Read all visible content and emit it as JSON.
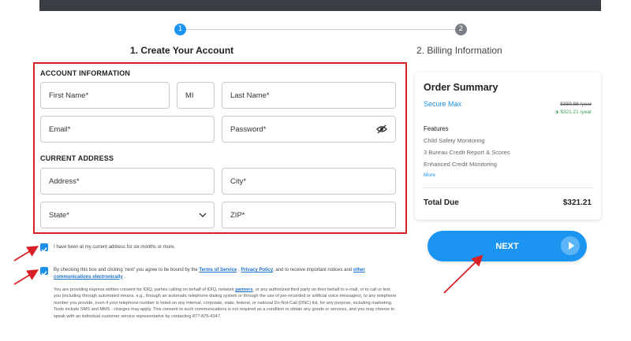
{
  "steps": [
    {
      "number": "1",
      "label": "1. Create Your Account"
    },
    {
      "number": "2",
      "label": "2. Billing Information"
    }
  ],
  "form": {
    "account_section": "ACCOUNT INFORMATION",
    "first_name_placeholder": "First Name*",
    "mi_placeholder": "MI",
    "last_name_placeholder": "Last Name*",
    "email_placeholder": "Email*",
    "password_placeholder": "Password*",
    "address_section": "CURRENT ADDRESS",
    "address_placeholder": "Address*",
    "city_placeholder": "City*",
    "state_placeholder": "State*",
    "zip_placeholder": "ZIP*"
  },
  "summary": {
    "title": "Order Summary",
    "plan_name": "Secure Max",
    "old_price": "$359.88 /year",
    "new_price": "$321.21 /year",
    "features_heading": "Features",
    "features": [
      "Child Safety Monitoring",
      "3 Bureau Credit Report & Scores",
      "Enhanced Credit Monitoring"
    ],
    "more_link": "More",
    "total_label": "Total Due",
    "total_value": "$321.21"
  },
  "next_button": "NEXT",
  "consent": {
    "address_checkbox": "I have been at my current address for six months or more.",
    "terms_prefix": "By checking this box and clicking 'next' you agree to be bound by the",
    "terms_link": "Terms of Service",
    "comma": ",",
    "privacy_link": "Privacy Policy",
    "terms_middle": ", and to receive important notices and",
    "other_comms_link": "other communications electronically",
    "period": "."
  },
  "legal": {
    "part1": "You are providing express written consent for IDIQ, parties calling on behalf of IDIQ, network",
    "partners_link": "partners",
    "part2": ", or any authorized third party on their behalf to e-mail, or to call or text you (including through automated means, e.g., through an automatic telephone dialing system or through the use of pre-recorded or artificial voice messages), to any telephone number you provide, even if your telephone number is listed on any internal, corporate, state, federal, or national Do-Not-Call (DNC) list, for any purpose, including marketing. Texts include SMS and MMS - charges may apply. This consent to such communications is not required as a condition to obtain any goods or services, and you may choose to speak with an individual customer service representative by contacting 877-875-4347."
  },
  "colors": {
    "accent": "#1c95f2",
    "highlight_border": "#d81f26",
    "arrow": "#d81f26"
  }
}
